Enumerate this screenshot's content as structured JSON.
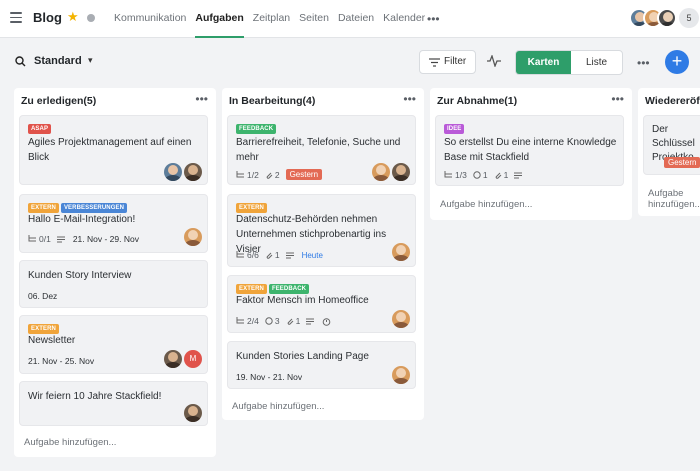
{
  "header": {
    "title": "Blog",
    "nav": [
      "Kommunikation",
      "Aufgaben",
      "Zeitplan",
      "Seiten",
      "Dateien",
      "Kalender"
    ],
    "active_nav": "Aufgaben",
    "more": "•••",
    "member_count": "5"
  },
  "toolbar": {
    "view": "Standard",
    "filter": "Filter",
    "karten": "Karten",
    "liste": "Liste",
    "more": "•••",
    "plus": "+"
  },
  "tag_colors": {
    "ASAP": "#e0534b",
    "EXTERN": "#f0a43a",
    "VERBESSERUNGEN": "#4a86d6",
    "FEEDBACK": "#3db46d",
    "IDEE": "#b95ad8"
  },
  "add_task_label": "Aufgabe hinzufügen...",
  "columns": [
    {
      "title": "Zu erledigen(5)",
      "cards": [
        {
          "tags": [
            "ASAP"
          ],
          "title": "Agiles Projektmanagement auf einen Blick"
        },
        {
          "tags": [
            "EXTERN",
            "VERBESSERUNGEN"
          ],
          "title": "Hallo E-Mail-Integration!",
          "subtasks": "0/1",
          "date": "21. Nov - 29. Nov"
        },
        {
          "tags": [],
          "title": "Kunden Story Interview",
          "date": "06. Dez"
        },
        {
          "tags": [
            "EXTERN"
          ],
          "title": "Newsletter",
          "date": "21. Nov - 25. Nov",
          "avatar_letter": "M"
        },
        {
          "tags": [],
          "title": "Wir feiern 10 Jahre Stackfield!"
        }
      ]
    },
    {
      "title": "In Bearbeitung(4)",
      "cards": [
        {
          "tags": [
            "FEEDBACK"
          ],
          "title": "Barrierefreiheit, Telefonie, Suche und mehr",
          "subtasks": "1/2",
          "attachments": "2",
          "badge": "Gestern"
        },
        {
          "tags": [
            "EXTERN"
          ],
          "title": "Datenschutz-Behörden nehmen Unternehmen stichprobenartig ins Visier",
          "subtasks": "6/6",
          "attachments": "1",
          "due": "Heute"
        },
        {
          "tags": [
            "EXTERN",
            "FEEDBACK"
          ],
          "title": "Faktor Mensch im Homeoffice",
          "subtasks": "2/4",
          "comments": "3",
          "attachments": "1"
        },
        {
          "tags": [],
          "title": "Kunden Stories Landing Page",
          "date": "19. Nov - 21. Nov"
        }
      ]
    },
    {
      "title": "Zur Abnahme(1)",
      "cards": [
        {
          "tags": [
            "IDEE"
          ],
          "title": "So erstellst Du eine interne Knowledge Base mit Stackfield",
          "subtasks": "1/3",
          "comments": "1",
          "attachments": "1"
        }
      ]
    },
    {
      "title": "Wiedereröffnet",
      "cards": [
        {
          "tags": [],
          "title": "Der Schlüssel Projektko",
          "badge": "Gestern"
        }
      ]
    }
  ]
}
